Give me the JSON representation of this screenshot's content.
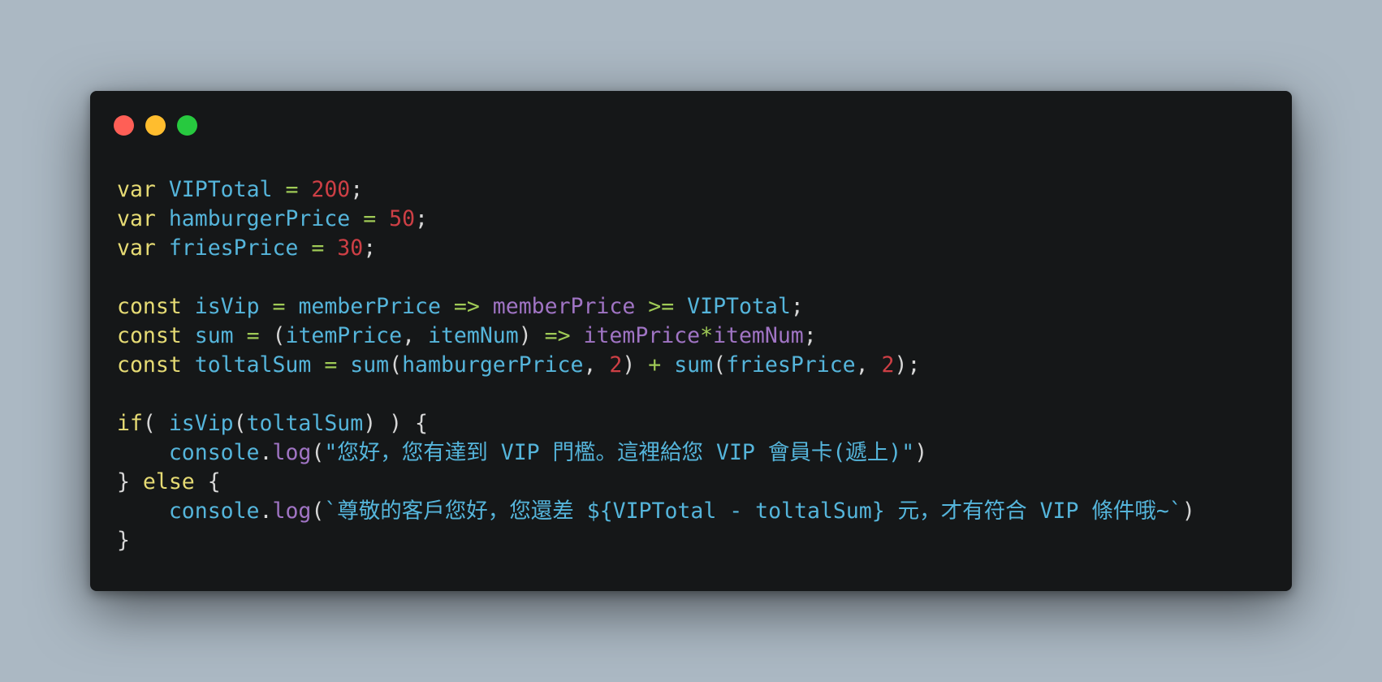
{
  "window": {
    "controls": [
      {
        "name": "close-button",
        "color": "#ff5f56"
      },
      {
        "name": "minimize-button",
        "color": "#ffbd2e"
      },
      {
        "name": "maximize-button",
        "color": "#27c93f"
      }
    ]
  },
  "code": {
    "lines": [
      [
        [
          "k",
          "var"
        ],
        [
          "p",
          " "
        ],
        [
          "i",
          "VIPTotal"
        ],
        [
          "p",
          " "
        ],
        [
          "o",
          "="
        ],
        [
          "p",
          " "
        ],
        [
          "n",
          "200"
        ],
        [
          "p",
          ";"
        ]
      ],
      [
        [
          "k",
          "var"
        ],
        [
          "p",
          " "
        ],
        [
          "i",
          "hamburgerPrice"
        ],
        [
          "p",
          " "
        ],
        [
          "o",
          "="
        ],
        [
          "p",
          " "
        ],
        [
          "n",
          "50"
        ],
        [
          "p",
          ";"
        ]
      ],
      [
        [
          "k",
          "var"
        ],
        [
          "p",
          " "
        ],
        [
          "i",
          "friesPrice"
        ],
        [
          "p",
          " "
        ],
        [
          "o",
          "="
        ],
        [
          "p",
          " "
        ],
        [
          "n",
          "30"
        ],
        [
          "p",
          ";"
        ]
      ],
      [],
      [
        [
          "k",
          "const"
        ],
        [
          "p",
          " "
        ],
        [
          "i",
          "isVip"
        ],
        [
          "p",
          " "
        ],
        [
          "o",
          "="
        ],
        [
          "p",
          " "
        ],
        [
          "i",
          "memberPrice"
        ],
        [
          "p",
          " "
        ],
        [
          "o",
          "=>"
        ],
        [
          "p",
          " "
        ],
        [
          "m",
          "memberPrice"
        ],
        [
          "p",
          " "
        ],
        [
          "o",
          ">="
        ],
        [
          "p",
          " "
        ],
        [
          "i",
          "VIPTotal"
        ],
        [
          "p",
          ";"
        ]
      ],
      [
        [
          "k",
          "const"
        ],
        [
          "p",
          " "
        ],
        [
          "i",
          "sum"
        ],
        [
          "p",
          " "
        ],
        [
          "o",
          "="
        ],
        [
          "p",
          " ("
        ],
        [
          "i",
          "itemPrice"
        ],
        [
          "p",
          ", "
        ],
        [
          "i",
          "itemNum"
        ],
        [
          "p",
          ") "
        ],
        [
          "o",
          "=>"
        ],
        [
          "p",
          " "
        ],
        [
          "m",
          "itemPrice"
        ],
        [
          "o",
          "*"
        ],
        [
          "m",
          "itemNum"
        ],
        [
          "p",
          ";"
        ]
      ],
      [
        [
          "k",
          "const"
        ],
        [
          "p",
          " "
        ],
        [
          "i",
          "toltalSum"
        ],
        [
          "p",
          " "
        ],
        [
          "o",
          "="
        ],
        [
          "p",
          " "
        ],
        [
          "i",
          "sum"
        ],
        [
          "p",
          "("
        ],
        [
          "i",
          "hamburgerPrice"
        ],
        [
          "p",
          ", "
        ],
        [
          "n",
          "2"
        ],
        [
          "p",
          ") "
        ],
        [
          "o",
          "+"
        ],
        [
          "p",
          " "
        ],
        [
          "i",
          "sum"
        ],
        [
          "p",
          "("
        ],
        [
          "i",
          "friesPrice"
        ],
        [
          "p",
          ", "
        ],
        [
          "n",
          "2"
        ],
        [
          "p",
          ");"
        ]
      ],
      [],
      [
        [
          "k",
          "if"
        ],
        [
          "p",
          "( "
        ],
        [
          "i",
          "isVip"
        ],
        [
          "p",
          "("
        ],
        [
          "i",
          "toltalSum"
        ],
        [
          "p",
          ") ) {"
        ]
      ],
      [
        [
          "p",
          "    "
        ],
        [
          "i",
          "console"
        ],
        [
          "p",
          "."
        ],
        [
          "m",
          "log"
        ],
        [
          "p",
          "("
        ],
        [
          "s",
          "\"您好，您有達到 VIP 門檻。這裡給您 VIP 會員卡(遞上)\""
        ],
        [
          "p",
          ")"
        ]
      ],
      [
        [
          "p",
          "} "
        ],
        [
          "k",
          "else"
        ],
        [
          "p",
          " {"
        ]
      ],
      [
        [
          "p",
          "    "
        ],
        [
          "i",
          "console"
        ],
        [
          "p",
          "."
        ],
        [
          "m",
          "log"
        ],
        [
          "p",
          "("
        ],
        [
          "s",
          "`尊敬的客戶您好，您還差 ${VIPTotal - toltalSum} 元，才有符合 VIP 條件哦~`"
        ],
        [
          "p",
          ")"
        ]
      ],
      [
        [
          "p",
          "}"
        ]
      ]
    ]
  }
}
